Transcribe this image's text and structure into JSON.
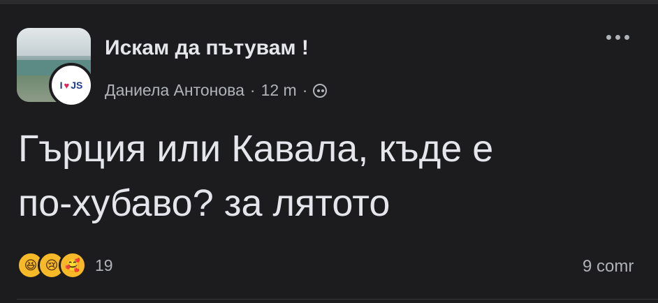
{
  "group": {
    "name": "Искам да пътувам !"
  },
  "author": {
    "name": "Даниела Антонова",
    "time": "12 m",
    "separator": "·",
    "avatar_text_left": "I",
    "avatar_text_right": "JS",
    "privacy_icon": "globe-icon"
  },
  "post": {
    "line1": "Гърция или Кавала, къде е",
    "line2": "по-хубаво? за лятото"
  },
  "reactions": {
    "emojis": [
      "laugh-emoji",
      "sad-emoji",
      "care-emoji"
    ],
    "count": "19"
  },
  "comments": {
    "label": "9 comr"
  },
  "colors": {
    "background": "#1c1c1e",
    "primary_text": "#e4e6eb",
    "secondary_text": "#b0b3b8",
    "reaction_yellow": "#f7b928"
  }
}
